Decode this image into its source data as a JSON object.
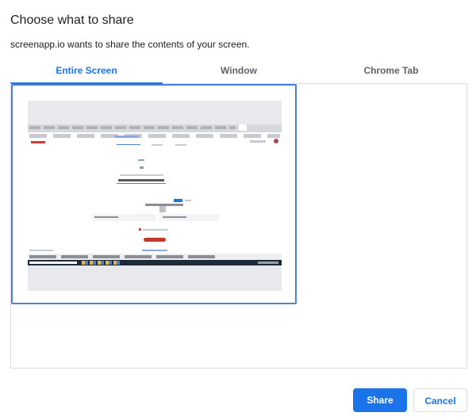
{
  "dialog": {
    "title": "Choose what to share",
    "subtitle": "screenapp.io wants to share the contents of your screen."
  },
  "tabs": [
    {
      "label": "Entire Screen",
      "active": true
    },
    {
      "label": "Window",
      "active": false
    },
    {
      "label": "Chrome Tab",
      "active": false
    }
  ],
  "buttons": {
    "share_label": "Share",
    "cancel_label": "Cancel"
  },
  "colors": {
    "accent": "#1a73e8",
    "selection_border": "#4a80d8",
    "border": "#dadce0"
  }
}
